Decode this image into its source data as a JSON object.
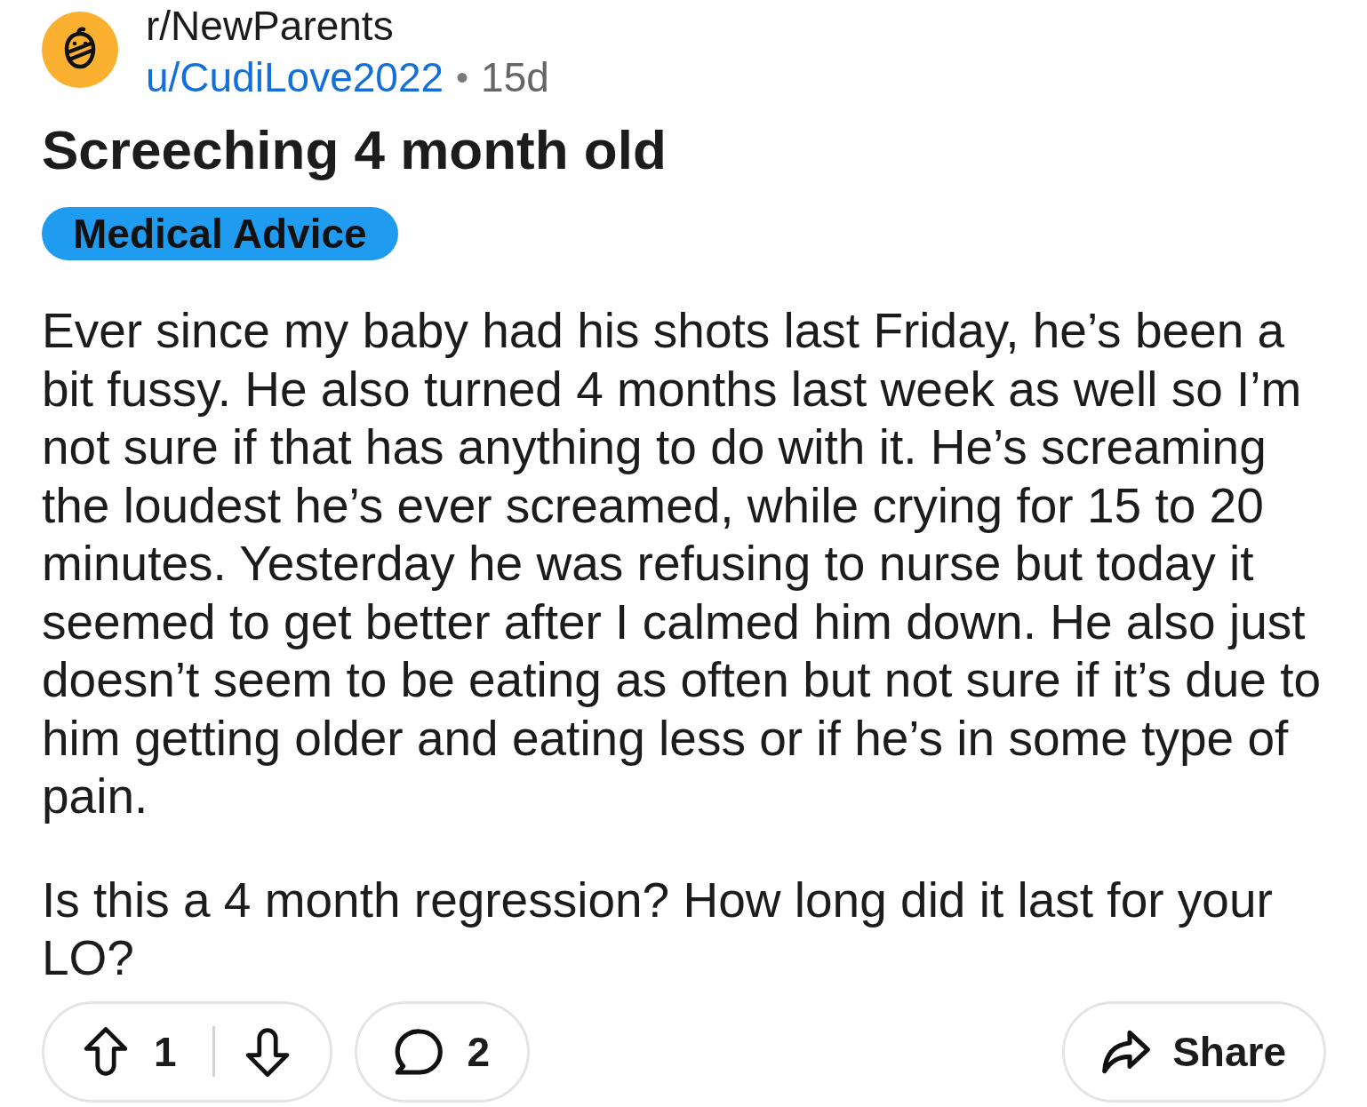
{
  "post": {
    "community": "r/NewParents",
    "author": "u/CudiLove2022",
    "separator": "•",
    "age": "15d",
    "title": "Screeching 4 month old",
    "flair": "Medical Advice",
    "body": [
      "Ever since my baby had his shots last Friday, he’s been a bit fussy. He also turned 4 months last week as well so I’m not sure if that has anything to do with it. He’s screaming the loudest he’s ever screamed, while crying for 15 to 20 minutes. Yesterday he was refusing to nurse but today it seemed to get better after I calmed him down. He also just doesn’t seem to be eating as often but not sure if it’s due to him getting older and eating less or if he’s in some type of pain.",
      "Is this a 4 month regression? How long did it last for your LO?"
    ]
  },
  "actions": {
    "score": "1",
    "comments": "2",
    "share": "Share"
  }
}
